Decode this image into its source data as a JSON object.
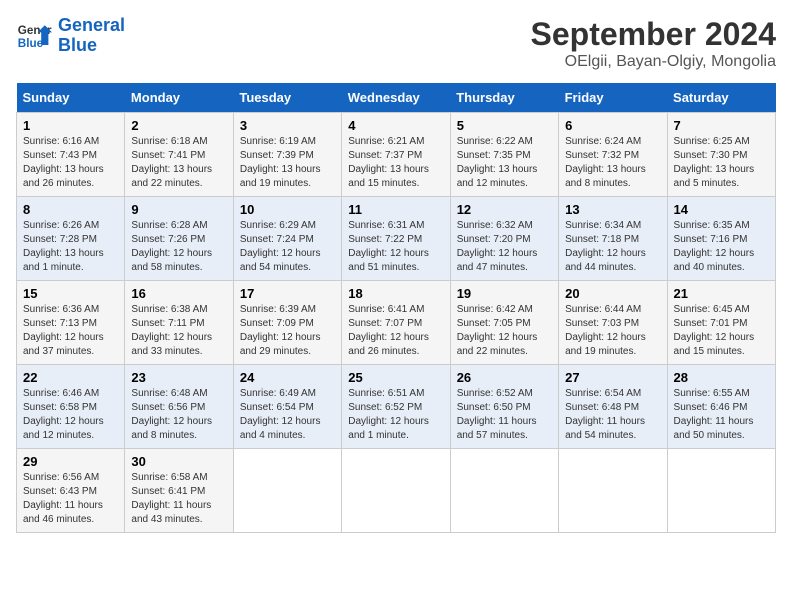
{
  "header": {
    "logo_line1": "General",
    "logo_line2": "Blue",
    "main_title": "September 2024",
    "sub_title": "OElgii, Bayan-Olgiy, Mongolia"
  },
  "days_of_week": [
    "Sunday",
    "Monday",
    "Tuesday",
    "Wednesday",
    "Thursday",
    "Friday",
    "Saturday"
  ],
  "weeks": [
    [
      {
        "num": "1",
        "rise": "Sunrise: 6:16 AM",
        "set": "Sunset: 7:43 PM",
        "daylight": "Daylight: 13 hours and 26 minutes."
      },
      {
        "num": "2",
        "rise": "Sunrise: 6:18 AM",
        "set": "Sunset: 7:41 PM",
        "daylight": "Daylight: 13 hours and 22 minutes."
      },
      {
        "num": "3",
        "rise": "Sunrise: 6:19 AM",
        "set": "Sunset: 7:39 PM",
        "daylight": "Daylight: 13 hours and 19 minutes."
      },
      {
        "num": "4",
        "rise": "Sunrise: 6:21 AM",
        "set": "Sunset: 7:37 PM",
        "daylight": "Daylight: 13 hours and 15 minutes."
      },
      {
        "num": "5",
        "rise": "Sunrise: 6:22 AM",
        "set": "Sunset: 7:35 PM",
        "daylight": "Daylight: 13 hours and 12 minutes."
      },
      {
        "num": "6",
        "rise": "Sunrise: 6:24 AM",
        "set": "Sunset: 7:32 PM",
        "daylight": "Daylight: 13 hours and 8 minutes."
      },
      {
        "num": "7",
        "rise": "Sunrise: 6:25 AM",
        "set": "Sunset: 7:30 PM",
        "daylight": "Daylight: 13 hours and 5 minutes."
      }
    ],
    [
      {
        "num": "8",
        "rise": "Sunrise: 6:26 AM",
        "set": "Sunset: 7:28 PM",
        "daylight": "Daylight: 13 hours and 1 minute."
      },
      {
        "num": "9",
        "rise": "Sunrise: 6:28 AM",
        "set": "Sunset: 7:26 PM",
        "daylight": "Daylight: 12 hours and 58 minutes."
      },
      {
        "num": "10",
        "rise": "Sunrise: 6:29 AM",
        "set": "Sunset: 7:24 PM",
        "daylight": "Daylight: 12 hours and 54 minutes."
      },
      {
        "num": "11",
        "rise": "Sunrise: 6:31 AM",
        "set": "Sunset: 7:22 PM",
        "daylight": "Daylight: 12 hours and 51 minutes."
      },
      {
        "num": "12",
        "rise": "Sunrise: 6:32 AM",
        "set": "Sunset: 7:20 PM",
        "daylight": "Daylight: 12 hours and 47 minutes."
      },
      {
        "num": "13",
        "rise": "Sunrise: 6:34 AM",
        "set": "Sunset: 7:18 PM",
        "daylight": "Daylight: 12 hours and 44 minutes."
      },
      {
        "num": "14",
        "rise": "Sunrise: 6:35 AM",
        "set": "Sunset: 7:16 PM",
        "daylight": "Daylight: 12 hours and 40 minutes."
      }
    ],
    [
      {
        "num": "15",
        "rise": "Sunrise: 6:36 AM",
        "set": "Sunset: 7:13 PM",
        "daylight": "Daylight: 12 hours and 37 minutes."
      },
      {
        "num": "16",
        "rise": "Sunrise: 6:38 AM",
        "set": "Sunset: 7:11 PM",
        "daylight": "Daylight: 12 hours and 33 minutes."
      },
      {
        "num": "17",
        "rise": "Sunrise: 6:39 AM",
        "set": "Sunset: 7:09 PM",
        "daylight": "Daylight: 12 hours and 29 minutes."
      },
      {
        "num": "18",
        "rise": "Sunrise: 6:41 AM",
        "set": "Sunset: 7:07 PM",
        "daylight": "Daylight: 12 hours and 26 minutes."
      },
      {
        "num": "19",
        "rise": "Sunrise: 6:42 AM",
        "set": "Sunset: 7:05 PM",
        "daylight": "Daylight: 12 hours and 22 minutes."
      },
      {
        "num": "20",
        "rise": "Sunrise: 6:44 AM",
        "set": "Sunset: 7:03 PM",
        "daylight": "Daylight: 12 hours and 19 minutes."
      },
      {
        "num": "21",
        "rise": "Sunrise: 6:45 AM",
        "set": "Sunset: 7:01 PM",
        "daylight": "Daylight: 12 hours and 15 minutes."
      }
    ],
    [
      {
        "num": "22",
        "rise": "Sunrise: 6:46 AM",
        "set": "Sunset: 6:58 PM",
        "daylight": "Daylight: 12 hours and 12 minutes."
      },
      {
        "num": "23",
        "rise": "Sunrise: 6:48 AM",
        "set": "Sunset: 6:56 PM",
        "daylight": "Daylight: 12 hours and 8 minutes."
      },
      {
        "num": "24",
        "rise": "Sunrise: 6:49 AM",
        "set": "Sunset: 6:54 PM",
        "daylight": "Daylight: 12 hours and 4 minutes."
      },
      {
        "num": "25",
        "rise": "Sunrise: 6:51 AM",
        "set": "Sunset: 6:52 PM",
        "daylight": "Daylight: 12 hours and 1 minute."
      },
      {
        "num": "26",
        "rise": "Sunrise: 6:52 AM",
        "set": "Sunset: 6:50 PM",
        "daylight": "Daylight: 11 hours and 57 minutes."
      },
      {
        "num": "27",
        "rise": "Sunrise: 6:54 AM",
        "set": "Sunset: 6:48 PM",
        "daylight": "Daylight: 11 hours and 54 minutes."
      },
      {
        "num": "28",
        "rise": "Sunrise: 6:55 AM",
        "set": "Sunset: 6:46 PM",
        "daylight": "Daylight: 11 hours and 50 minutes."
      }
    ],
    [
      {
        "num": "29",
        "rise": "Sunrise: 6:56 AM",
        "set": "Sunset: 6:43 PM",
        "daylight": "Daylight: 11 hours and 46 minutes."
      },
      {
        "num": "30",
        "rise": "Sunrise: 6:58 AM",
        "set": "Sunset: 6:41 PM",
        "daylight": "Daylight: 11 hours and 43 minutes."
      },
      null,
      null,
      null,
      null,
      null
    ]
  ]
}
